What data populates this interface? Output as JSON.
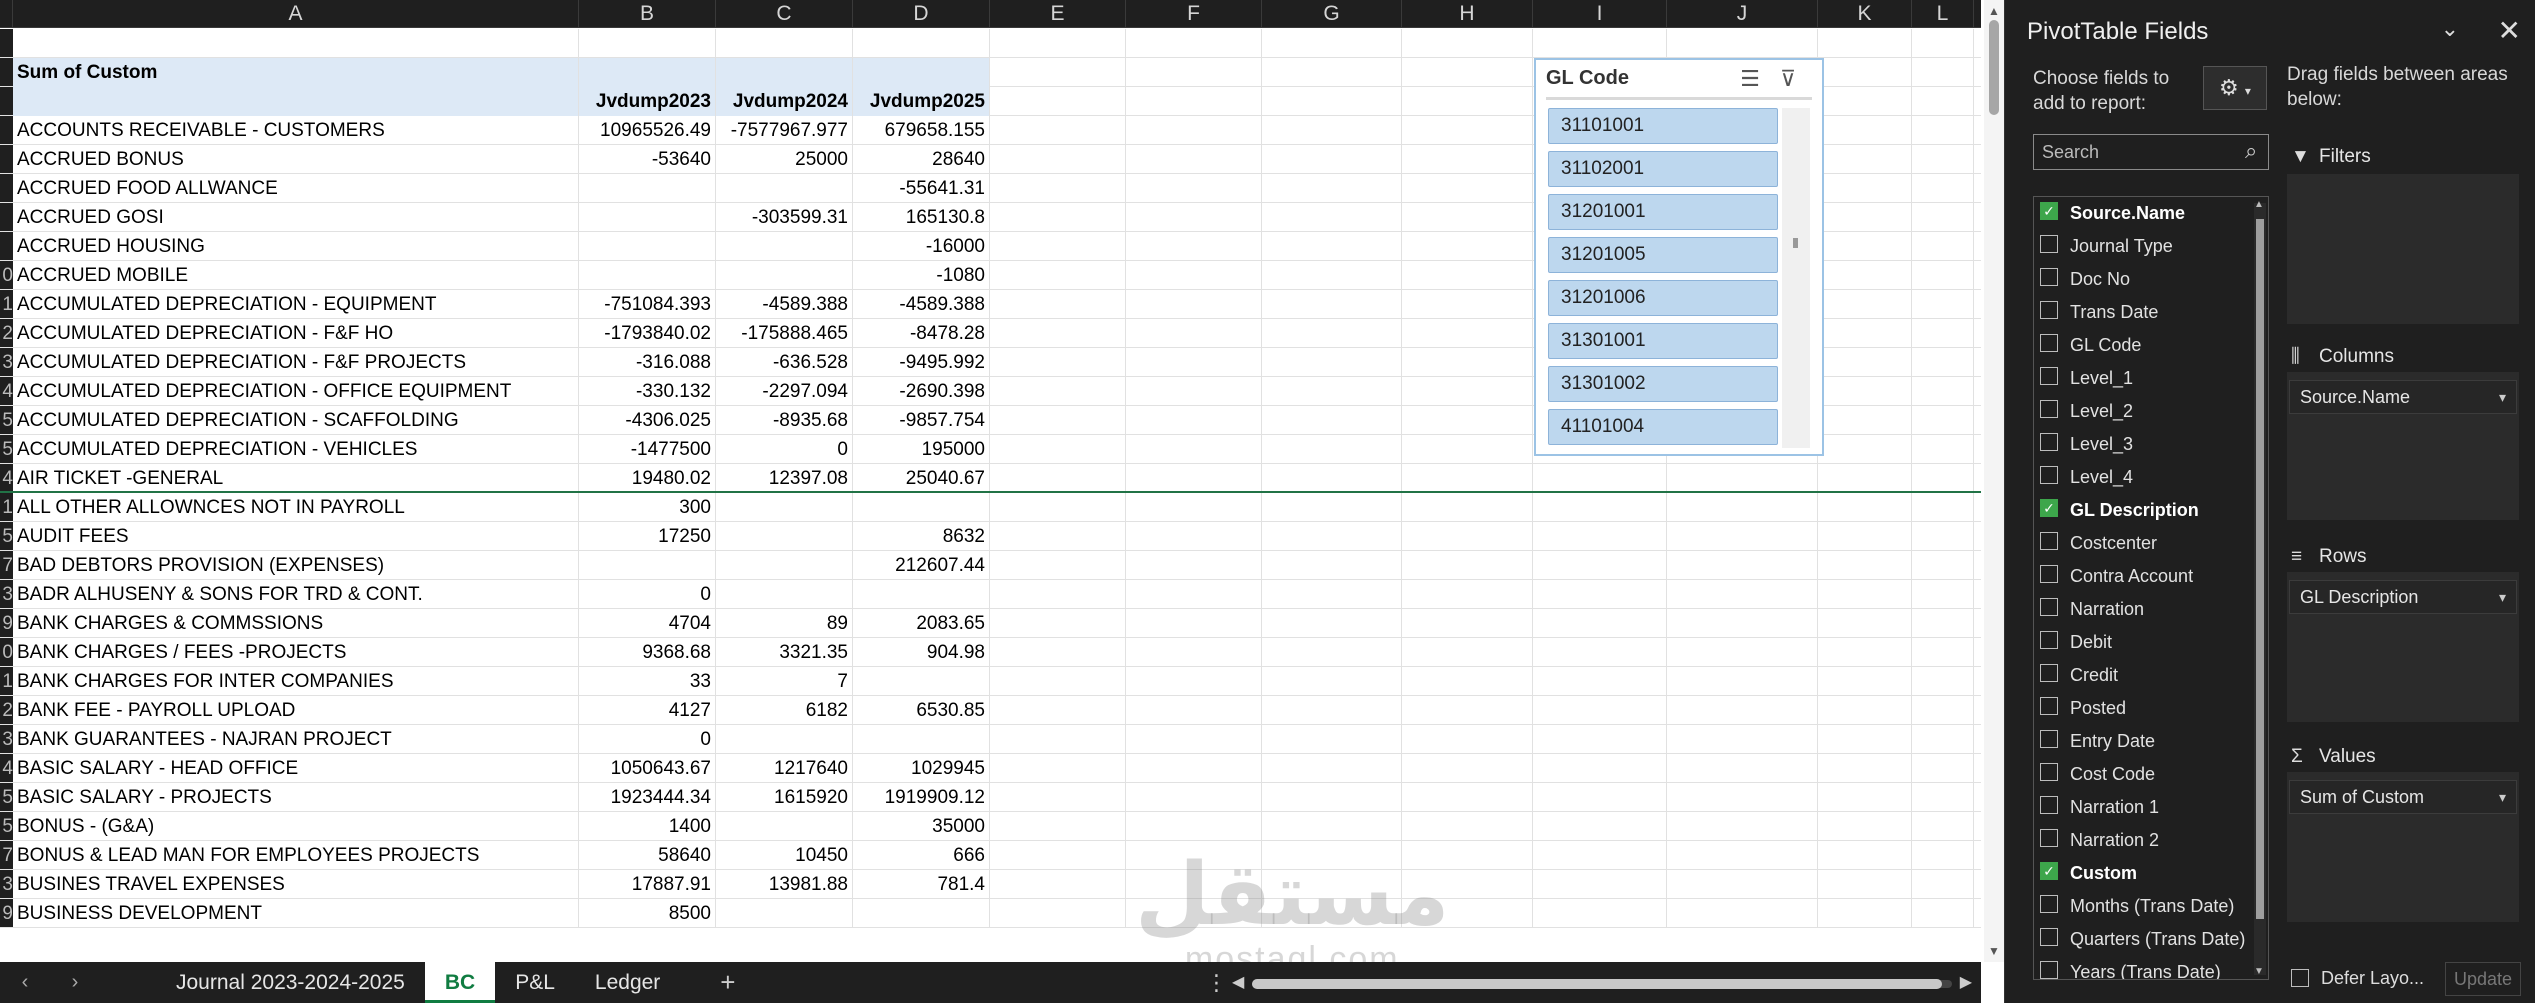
{
  "columns": [
    "A",
    "B",
    "C",
    "D",
    "E",
    "F",
    "G",
    "H",
    "I",
    "J",
    "K",
    "L"
  ],
  "pivot": {
    "header_label": "Sum of Custom",
    "col_labels": [
      "Jvdump2023",
      "Jvdump2024",
      "Jvdump2025"
    ],
    "rows": [
      {
        "rn": "",
        "label": "ACCOUNTS RECEIVABLE - CUSTOMERS",
        "b": "10965526.49",
        "c": "-7577967.977",
        "d": "679658.155"
      },
      {
        "rn": "",
        "label": "ACCRUED BONUS",
        "b": "-53640",
        "c": "25000",
        "d": "28640"
      },
      {
        "rn": "",
        "label": "ACCRUED FOOD ALLWANCE",
        "b": "",
        "c": "",
        "d": "-55641.31"
      },
      {
        "rn": "",
        "label": "ACCRUED GOSI",
        "b": "",
        "c": "-303599.31",
        "d": "165130.8"
      },
      {
        "rn": "",
        "label": "ACCRUED HOUSING",
        "b": "",
        "c": "",
        "d": "-16000"
      },
      {
        "rn": "0",
        "label": "ACCRUED MOBILE",
        "b": "",
        "c": "",
        "d": "-1080"
      },
      {
        "rn": "1",
        "label": "ACCUMULATED DEPRECIATION - EQUIPMENT",
        "b": "-751084.393",
        "c": "-4589.388",
        "d": "-4589.388"
      },
      {
        "rn": "2",
        "label": "ACCUMULATED DEPRECIATION - F&F HO",
        "b": "-1793840.02",
        "c": "-175888.465",
        "d": "-8478.28"
      },
      {
        "rn": "3",
        "label": "ACCUMULATED DEPRECIATION - F&F PROJECTS",
        "b": "-316.088",
        "c": "-636.528",
        "d": "-9495.992"
      },
      {
        "rn": "4",
        "label": "ACCUMULATED DEPRECIATION - OFFICE EQUIPMENT",
        "b": "-330.132",
        "c": "-2297.094",
        "d": "-2690.398"
      },
      {
        "rn": "5",
        "label": "ACCUMULATED DEPRECIATION - SCAFFOLDING",
        "b": "-4306.025",
        "c": "-8935.68",
        "d": "-9857.754"
      },
      {
        "rn": "5",
        "label": "ACCUMULATED DEPRECIATION - VEHICLES",
        "b": "-1477500",
        "c": "0",
        "d": "195000"
      },
      {
        "rn": "4",
        "label": "AIR TICKET -GENERAL",
        "b": "19480.02",
        "c": "12397.08",
        "d": "25040.67"
      },
      {
        "rn": "1",
        "label": "ALL OTHER ALLOWNCES NOT IN PAYROLL",
        "b": "300",
        "c": "",
        "d": ""
      },
      {
        "rn": "5",
        "label": "AUDIT FEES",
        "b": "17250",
        "c": "",
        "d": "8632"
      },
      {
        "rn": "7",
        "label": "BAD DEBTORS PROVISION (EXPENSES)",
        "b": "",
        "c": "",
        "d": "212607.44"
      },
      {
        "rn": "3",
        "label": "BADR ALHUSENY & SONS FOR TRD & CONT.",
        "b": "0",
        "c": "",
        "d": ""
      },
      {
        "rn": "9",
        "label": "BANK CHARGES & COMMSSIONS",
        "b": "4704",
        "c": "89",
        "d": "2083.65"
      },
      {
        "rn": "0",
        "label": "BANK CHARGES / FEES  -PROJECTS",
        "b": "9368.68",
        "c": "3321.35",
        "d": "904.98"
      },
      {
        "rn": "1",
        "label": "BANK CHARGES FOR INTER COMPANIES",
        "b": "33",
        "c": "7",
        "d": ""
      },
      {
        "rn": "2",
        "label": "BANK FEE - PAYROLL UPLOAD",
        "b": "4127",
        "c": "6182",
        "d": "6530.85"
      },
      {
        "rn": "3",
        "label": "BANK GUARANTEES - NAJRAN PROJECT",
        "b": "0",
        "c": "",
        "d": ""
      },
      {
        "rn": "4",
        "label": "BASIC SALARY - HEAD OFFICE",
        "b": "1050643.67",
        "c": "1217640",
        "d": "1029945"
      },
      {
        "rn": "5",
        "label": "BASIC SALARY - PROJECTS",
        "b": "1923444.34",
        "c": "1615920",
        "d": "1919909.12"
      },
      {
        "rn": "5",
        "label": "BONUS - (G&A)",
        "b": "1400",
        "c": "",
        "d": "35000"
      },
      {
        "rn": "7",
        "label": "BONUS & LEAD MAN FOR EMPLOYEES PROJECTS",
        "b": "58640",
        "c": "10450",
        "d": "666"
      },
      {
        "rn": "3",
        "label": "BUSINES TRAVEL EXPENSES",
        "b": "17887.91",
        "c": "13981.88",
        "d": "781.4"
      },
      {
        "rn": "9",
        "label": "BUSINESS DEVELOPMENT",
        "b": "8500",
        "c": "",
        "d": ""
      }
    ]
  },
  "slicer": {
    "title": "GL Code",
    "items": [
      "31101001",
      "31102001",
      "31201001",
      "31201005",
      "31201006",
      "31301001",
      "31301002",
      "41101004"
    ]
  },
  "tabs": {
    "items": [
      "Journal 2023-2024-2025",
      "BC",
      "P&L",
      "Ledger"
    ],
    "active": "BC",
    "add": "+",
    "more": "⋮"
  },
  "watermark": {
    "arabic": "مستقل",
    "latin": "mostaql.com"
  },
  "pane": {
    "title": "PivotTable Fields",
    "choose": "Choose fields to add to report:",
    "drag_hint": "Drag fields between areas below:",
    "search_placeholder": "Search",
    "fields": [
      {
        "name": "Source.Name",
        "checked": true
      },
      {
        "name": "Journal Type",
        "checked": false
      },
      {
        "name": "Doc No",
        "checked": false
      },
      {
        "name": "Trans Date",
        "checked": false
      },
      {
        "name": "GL Code",
        "checked": false
      },
      {
        "name": "Level_1",
        "checked": false
      },
      {
        "name": "Level_2",
        "checked": false
      },
      {
        "name": "Level_3",
        "checked": false
      },
      {
        "name": "Level_4",
        "checked": false
      },
      {
        "name": "GL Description",
        "checked": true
      },
      {
        "name": "Costcenter",
        "checked": false
      },
      {
        "name": "Contra Account",
        "checked": false
      },
      {
        "name": "Narration",
        "checked": false
      },
      {
        "name": "Debit",
        "checked": false
      },
      {
        "name": "Credit",
        "checked": false
      },
      {
        "name": "Posted",
        "checked": false
      },
      {
        "name": "Entry Date",
        "checked": false
      },
      {
        "name": "Cost Code",
        "checked": false
      },
      {
        "name": "Narration 1",
        "checked": false
      },
      {
        "name": "Narration 2",
        "checked": false
      },
      {
        "name": "Custom",
        "checked": true
      },
      {
        "name": "Months (Trans Date)",
        "checked": false
      },
      {
        "name": "Quarters (Trans Date)",
        "checked": false
      },
      {
        "name": "Years (Trans Date)",
        "checked": false
      }
    ],
    "areas": {
      "filters": {
        "label": "Filters"
      },
      "columns": {
        "label": "Columns",
        "item": "Source.Name"
      },
      "rows": {
        "label": "Rows",
        "item": "GL Description"
      },
      "values": {
        "label": "Values",
        "item": "Sum of Custom"
      }
    },
    "defer_label": "Defer Layo...",
    "update_label": "Update"
  }
}
